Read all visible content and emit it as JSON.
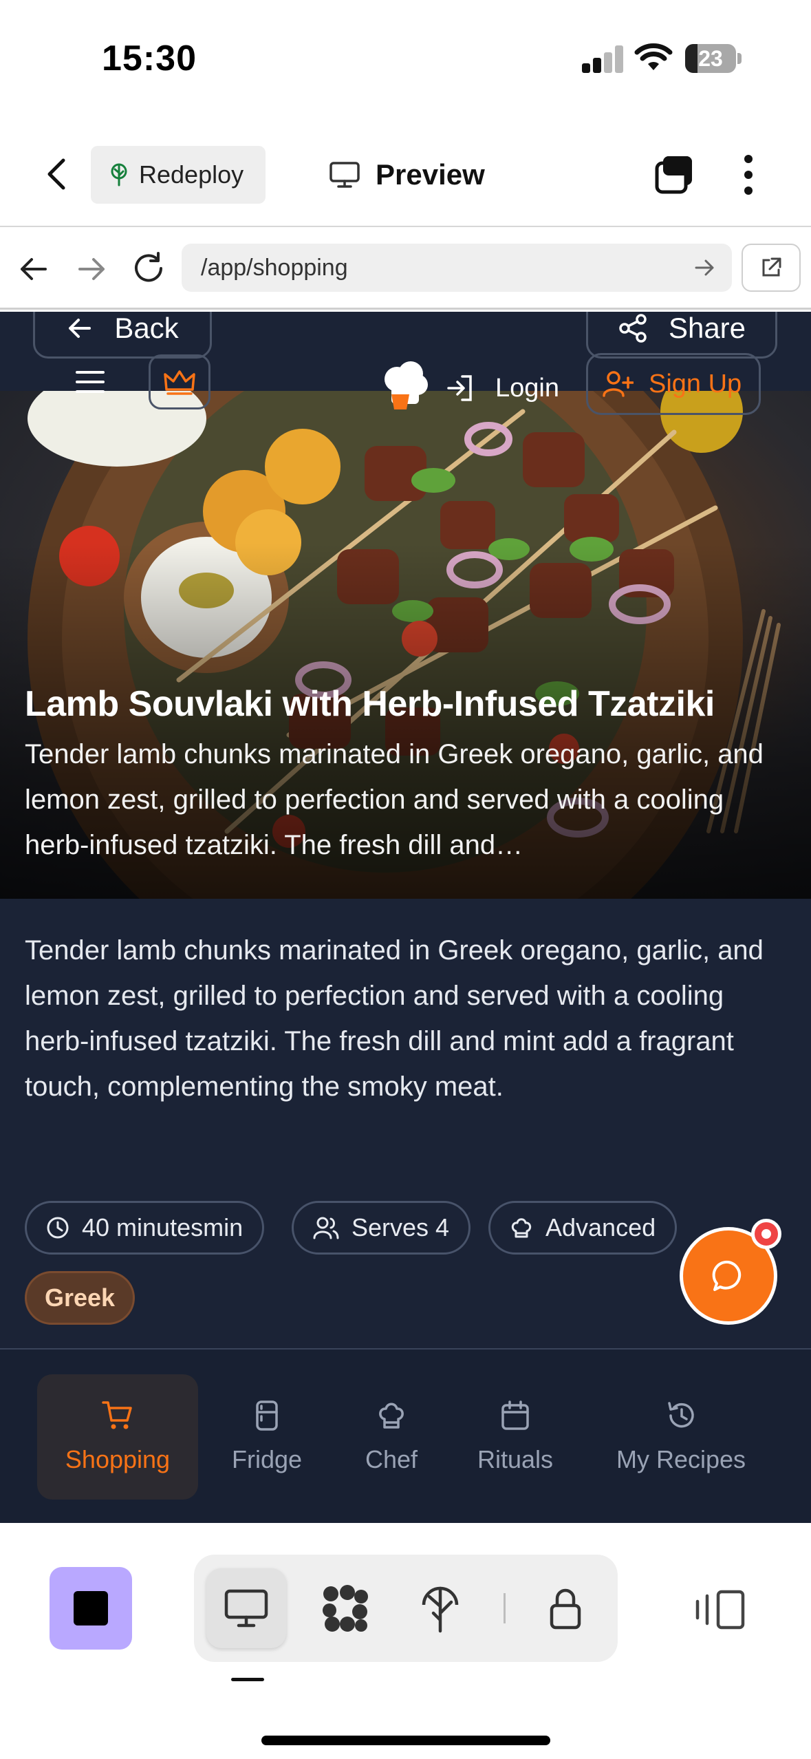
{
  "status_bar": {
    "time": "15:30",
    "battery": "23"
  },
  "app_bar": {
    "redeploy_label": "Redeploy",
    "preview_label": "Preview"
  },
  "browser": {
    "url": "/app/shopping"
  },
  "page": {
    "back_label": "Back",
    "share_label": "Share",
    "login_label": "Login",
    "signup_label": "Sign Up",
    "recipe": {
      "title": "Lamb Souvlaki with Herb-Infused Tzatziki",
      "hero_description": "Tender lamb chunks marinated in Greek oregano, garlic, and lemon zest, grilled to perfection and served with a cooling herb-infused tzatziki. The fresh dill and…",
      "description": "Tender lamb chunks marinated in Greek oregano, garlic, and lemon zest, grilled to perfection and served with a cooling herb-infused tzatziki. The fresh dill and mint add a fragrant touch, complementing the smoky meat.",
      "time": "40 minutesmin",
      "serves": "Serves 4",
      "difficulty": "Advanced",
      "cuisine": "Greek"
    },
    "bottom_nav": [
      {
        "label": "Shopping",
        "icon": "cart-icon",
        "active": true
      },
      {
        "label": "Fridge",
        "icon": "fridge-icon",
        "active": false
      },
      {
        "label": "Chef",
        "icon": "chef-hat-icon",
        "active": false
      },
      {
        "label": "Rituals",
        "icon": "calendar-icon",
        "active": false
      },
      {
        "label": "My Recipes",
        "icon": "history-icon",
        "active": false
      }
    ]
  },
  "colors": {
    "accent": "#f97316",
    "page_bg": "#1b2336",
    "nav_bg": "#182032",
    "stop_button": "#b9a8ff",
    "notification": "#ef4444"
  }
}
